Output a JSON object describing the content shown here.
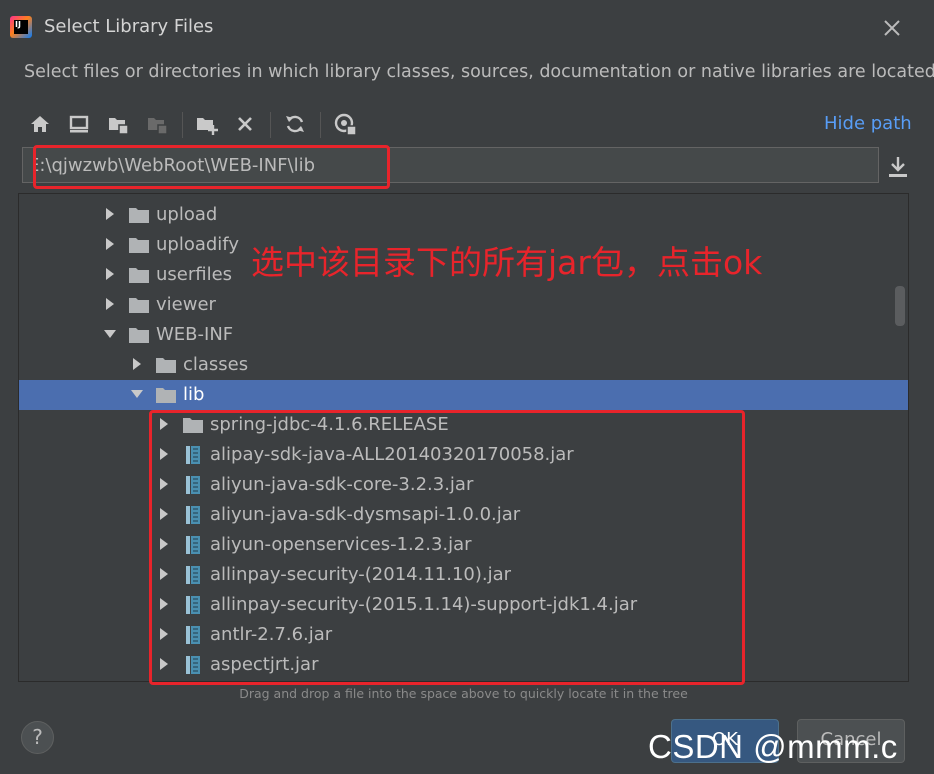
{
  "window": {
    "title": "Select Library Files",
    "description": "Select files or directories in which library classes, sources, documentation or native libraries are located"
  },
  "toolbar": {
    "buttons": [
      "home-icon",
      "desktop-icon",
      "project-folder-icon",
      "module-folder-icon",
      "new-folder-icon",
      "delete-icon",
      "refresh-icon",
      "show-hidden-icon"
    ],
    "hide_path_label": "Hide path"
  },
  "path": {
    "value": "E:\\qjwzwb\\WebRoot\\WEB-INF\\lib"
  },
  "tree": {
    "rows": [
      {
        "label": "upload",
        "type": "folder",
        "expanded": false,
        "depth": 1
      },
      {
        "label": "uploadify",
        "type": "folder",
        "expanded": false,
        "depth": 1
      },
      {
        "label": "userfiles",
        "type": "folder",
        "expanded": false,
        "depth": 1
      },
      {
        "label": "viewer",
        "type": "folder",
        "expanded": false,
        "depth": 1
      },
      {
        "label": "WEB-INF",
        "type": "folder",
        "expanded": true,
        "depth": 1
      },
      {
        "label": "classes",
        "type": "folder",
        "expanded": false,
        "depth": 2
      },
      {
        "label": "lib",
        "type": "folder",
        "expanded": true,
        "depth": 2,
        "selected": true
      },
      {
        "label": "spring-jdbc-4.1.6.RELEASE",
        "type": "folder",
        "expanded": false,
        "depth": 3
      },
      {
        "label": "alipay-sdk-java-ALL20140320170058.jar",
        "type": "jar",
        "expanded": false,
        "depth": 3
      },
      {
        "label": "aliyun-java-sdk-core-3.2.3.jar",
        "type": "jar",
        "expanded": false,
        "depth": 3
      },
      {
        "label": "aliyun-java-sdk-dysmsapi-1.0.0.jar",
        "type": "jar",
        "expanded": false,
        "depth": 3
      },
      {
        "label": "aliyun-openservices-1.2.3.jar",
        "type": "jar",
        "expanded": false,
        "depth": 3
      },
      {
        "label": "allinpay-security-(2014.11.10).jar",
        "type": "jar",
        "expanded": false,
        "depth": 3
      },
      {
        "label": "allinpay-security-(2015.1.14)-support-jdk1.4.jar",
        "type": "jar",
        "expanded": false,
        "depth": 3
      },
      {
        "label": "antlr-2.7.6.jar",
        "type": "jar",
        "expanded": false,
        "depth": 3
      },
      {
        "label": "aspectjrt.jar",
        "type": "jar",
        "expanded": false,
        "depth": 3
      }
    ]
  },
  "annotation": {
    "text": "选中该目录下的所有jar包，点击ok",
    "color": "#e8242b"
  },
  "hint": "Drag and drop a file into the space above to quickly locate it in the tree",
  "buttons": {
    "help": "?",
    "ok": "OK",
    "cancel": "Cancel"
  },
  "watermark": "CSDN @mmm.c",
  "colors": {
    "background": "#3c3f41",
    "selection": "#4b6eaf",
    "link": "#589df6",
    "primary_button": "#365880"
  }
}
